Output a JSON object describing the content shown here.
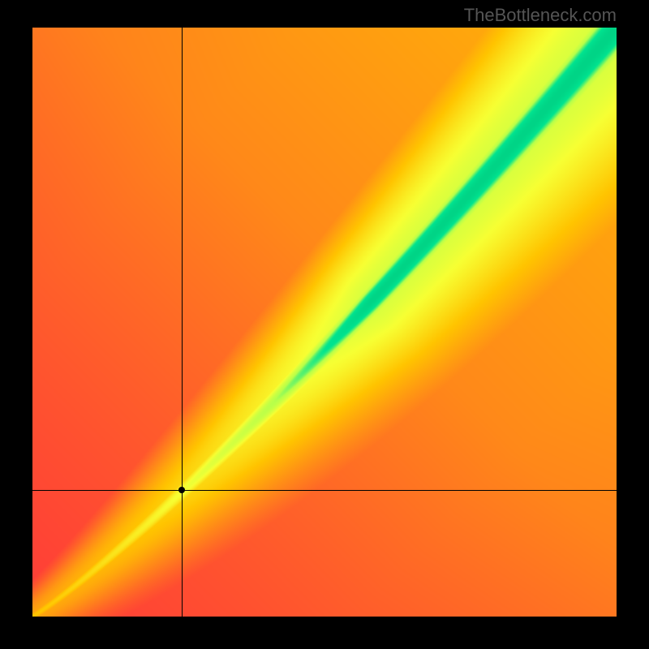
{
  "watermark": "TheBottleneck.com",
  "chart_data": {
    "type": "heatmap",
    "title": "",
    "xlabel": "",
    "ylabel": "",
    "x_range": [
      0,
      1
    ],
    "y_range": [
      0,
      1
    ],
    "marker": {
      "x": 0.255,
      "y": 0.215
    },
    "crosshair": {
      "x": 0.255,
      "y": 0.215
    },
    "colorscale": [
      "#ff2a3f",
      "#ff8a2a",
      "#ffd600",
      "#ffff33",
      "#2affa0",
      "#00e090"
    ],
    "description": "Diagonal green optimal band from bottom-left to top-right on red-yellow gradient field"
  }
}
